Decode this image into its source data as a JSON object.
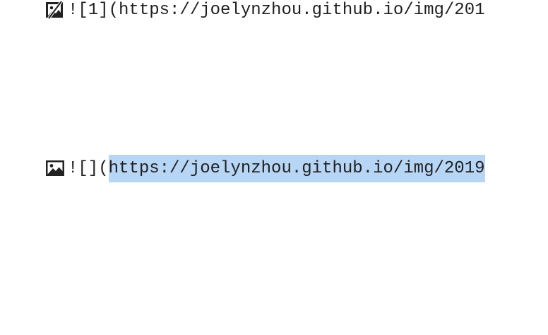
{
  "editor": {
    "lines": [
      {
        "icon": "broken-image-icon",
        "text": "![1](https://joelynzhou.github.io/img/201"
      },
      {
        "icon": "image-icon",
        "prefix": "![](",
        "selected": "https://joelynzhou.github.io/img/2019"
      }
    ],
    "selection_color": "#b7d5f5",
    "text_color": "#1f1f1f"
  }
}
